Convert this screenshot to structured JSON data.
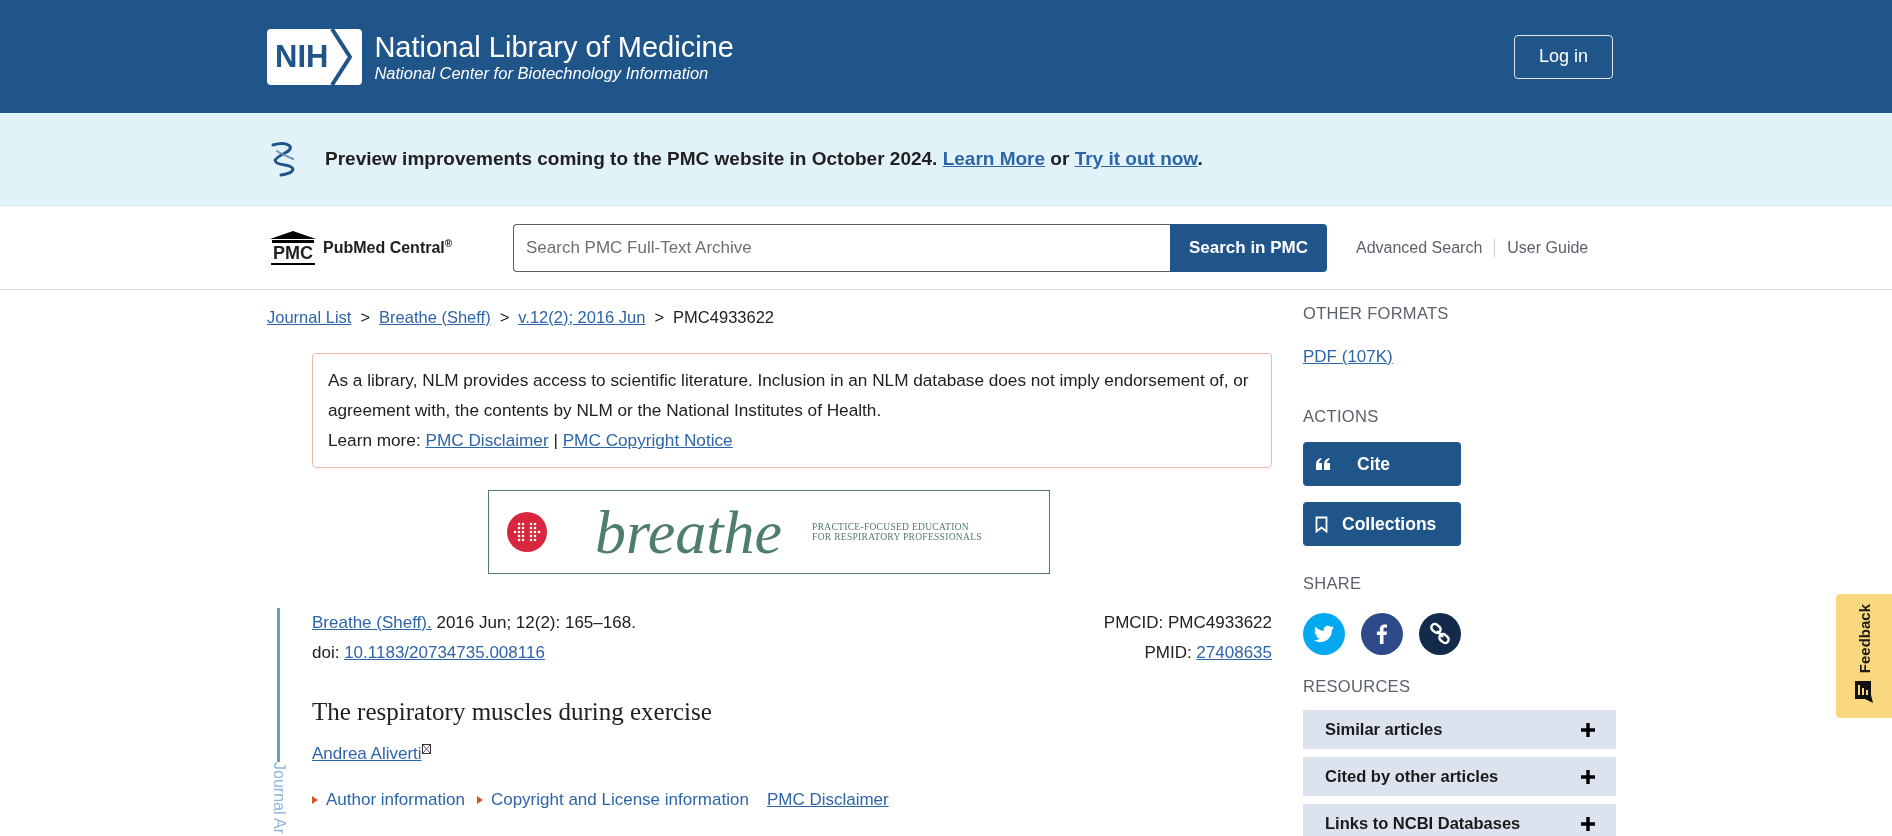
{
  "header": {
    "logo_text": "NIH",
    "title": "National Library of Medicine",
    "subtitle": "National Center for Biotechnology Information",
    "login_button": "Log in"
  },
  "banner": {
    "parts": [
      {
        "kind": "text",
        "text": "Preview improvements coming to the PMC website in October 2024. "
      },
      {
        "kind": "link",
        "text": "Learn More"
      },
      {
        "kind": "text",
        "text": " or "
      },
      {
        "kind": "link",
        "text": "Try it out now"
      },
      {
        "kind": "text",
        "text": "."
      }
    ]
  },
  "search_bar": {
    "logo_text": "PMC",
    "brand": "PubMed Central$^{®}$",
    "placeholder": "Search PMC Full-Text Archive",
    "button": "Search in PMC",
    "links": [
      "Advanced Search",
      "User Guide"
    ]
  },
  "breadcrumb": [
    {
      "kind": "link",
      "text": "Journal List"
    },
    {
      "kind": "separator",
      "text": ">"
    },
    {
      "kind": "link",
      "text": "Breathe (Sheff)"
    },
    {
      "kind": "separator",
      "text": ">"
    },
    {
      "kind": "link",
      "text": "v.12(2); 2016 Jun"
    },
    {
      "kind": "separator",
      "text": ">"
    },
    {
      "kind": "current",
      "text": "PMC4933622"
    }
  ],
  "notice": {
    "text": "As a library, NLM provides access to scientific literature. Inclusion in an NLM database does not imply endorsement of, or agreement with, the contents by NLM or the National Institutes of Health.",
    "learn_more": [
      {
        "kind": "text",
        "text": "Learn more: "
      },
      {
        "kind": "link",
        "text": "PMC Disclaimer"
      },
      {
        "kind": "text",
        "text": " | "
      },
      {
        "kind": "link",
        "text": "PMC Copyright Notice"
      }
    ]
  },
  "journal_banner": {
    "name": "breathe",
    "tagline": [
      "PRACTICE-FOCUSED EDUCATION",
      "FOR RESPIRATORY PROFESSIONALS"
    ]
  },
  "article": {
    "side_label": "Journal Ar",
    "citation": [
      {
        "kind": "link",
        "text": "Breathe (Sheff)."
      },
      {
        "kind": "text",
        "text": " 2016 Jun; 12(2): 165–168."
      }
    ],
    "doi": [
      {
        "kind": "text",
        "text": "doi: "
      },
      {
        "kind": "link",
        "text": "10.1183/20734735.008116"
      }
    ],
    "pmcid": [
      {
        "kind": "text",
        "text": "PMCID: PMC4933622"
      }
    ],
    "pmid": [
      {
        "kind": "text",
        "text": "PMID: "
      },
      {
        "kind": "link",
        "text": "27408635"
      }
    ],
    "title": "The respiratory muscles during exercise",
    "author": "Andrea Aliverti",
    "info_links": [
      {
        "kind": "toggle",
        "text": "Author information"
      },
      {
        "kind": "toggle",
        "text": "Copyright and License information"
      },
      {
        "kind": "link",
        "text": "PMC Disclaimer"
      }
    ]
  },
  "sidebar": {
    "other_formats": {
      "heading": "OTHER FORMATS",
      "link": "PDF (107K)"
    },
    "actions": {
      "heading": "ACTIONS",
      "buttons": [
        {
          "kind": "cite",
          "label": "Cite"
        },
        {
          "kind": "collections",
          "label": "Collections"
        }
      ]
    },
    "share": {
      "heading": "SHARE"
    },
    "resources": {
      "heading": "RESOURCES",
      "items": [
        {
          "label": "Similar articles",
          "expanded": false
        },
        {
          "label": "Cited by other articles",
          "expanded": false
        },
        {
          "label": "Links to NCBI Databases",
          "expanded": false
        }
      ]
    }
  },
  "feedback_tab": "Feedback"
}
